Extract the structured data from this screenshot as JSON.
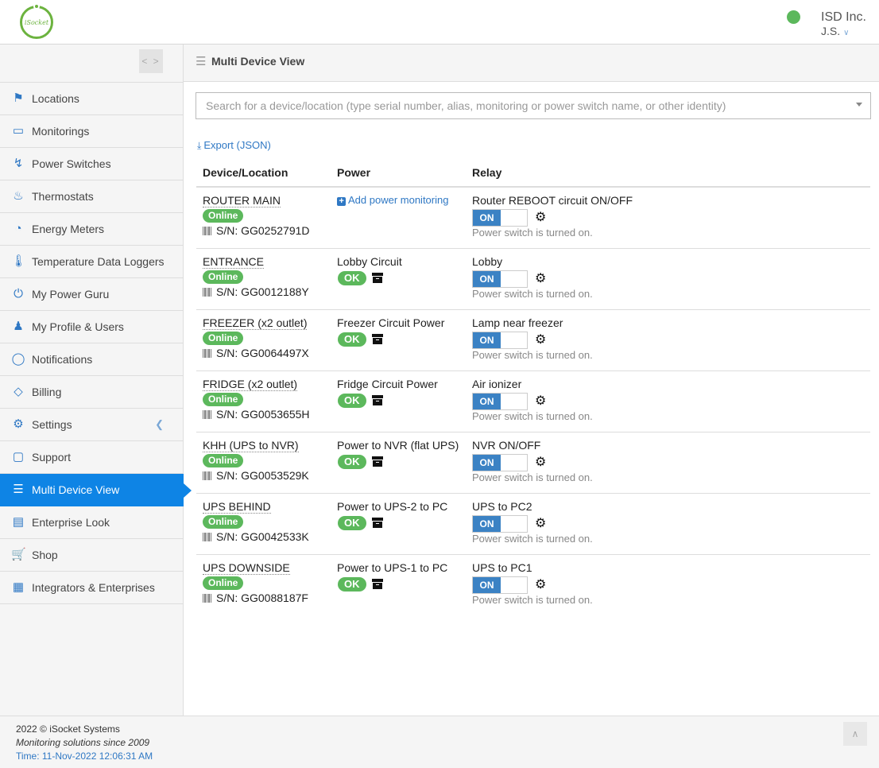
{
  "header": {
    "logo_text": "iSocket",
    "company": "ISD Inc.",
    "user": "J.S.",
    "status_color": "#5cb85c"
  },
  "sidebar": {
    "collapse_label": "< >",
    "items": [
      {
        "label": "Locations",
        "icon": "map-pin-icon"
      },
      {
        "label": "Monitorings",
        "icon": "monitor-icon"
      },
      {
        "label": "Power Switches",
        "icon": "plug-icon"
      },
      {
        "label": "Thermostats",
        "icon": "thermostat-icon"
      },
      {
        "label": "Energy Meters",
        "icon": "gauge-icon"
      },
      {
        "label": "Temperature Data Loggers",
        "icon": "thermometer-icon"
      },
      {
        "label": "My Power Guru",
        "icon": "power-icon"
      },
      {
        "label": "My Profile & Users",
        "icon": "users-icon"
      },
      {
        "label": "Notifications",
        "icon": "chat-bubble-icon"
      },
      {
        "label": "Billing",
        "icon": "tag-icon"
      },
      {
        "label": "Settings",
        "icon": "gears-icon"
      },
      {
        "label": "Support",
        "icon": "support-chat-icon"
      },
      {
        "label": "Multi Device View",
        "icon": "list-icon",
        "active": true
      },
      {
        "label": "Enterprise Look",
        "icon": "card-icon"
      },
      {
        "label": "Shop",
        "icon": "cart-icon"
      },
      {
        "label": "Integrators & Enterprises",
        "icon": "puzzle-icon"
      }
    ]
  },
  "main": {
    "title": "Multi Device View",
    "search_placeholder": "Search for a device/location (type serial number, alias, monitoring or power switch name, or other identity)",
    "export_label": "Export (JSON)",
    "columns": [
      "Device/Location",
      "Power",
      "Relay"
    ],
    "online_label": "Online",
    "ok_label": "OK",
    "on_label": "ON",
    "add_power_label": "Add power monitoring",
    "rows": [
      {
        "device": "ROUTER MAIN",
        "sn": "S/N: GG0252791D",
        "power": "",
        "relay": "Router REBOOT circuit ON/OFF",
        "relay_status": "Power switch is turned on."
      },
      {
        "device": "ENTRANCE",
        "sn": "S/N: GG0012188Y",
        "power": "Lobby Circuit",
        "relay": "Lobby",
        "relay_status": "Power switch is turned on."
      },
      {
        "device": "FREEZER (x2 outlet)",
        "sn": "S/N: GG0064497X",
        "power": "Freezer Circuit Power",
        "relay": "Lamp near freezer",
        "relay_status": "Power switch is turned on."
      },
      {
        "device": "FRIDGE (x2 outlet)",
        "sn": "S/N: GG0053655H",
        "power": "Fridge Circuit Power",
        "relay": "Air ionizer",
        "relay_status": "Power switch is turned on."
      },
      {
        "device": "KHH (UPS to NVR)",
        "sn": "S/N: GG0053529K",
        "power": "Power to NVR (flat UPS)",
        "relay": "NVR ON/OFF",
        "relay_status": "Power switch is turned on."
      },
      {
        "device": "UPS BEHIND",
        "sn": "S/N: GG0042533K",
        "power": "Power to UPS-2 to PC",
        "relay": "UPS to PC2",
        "relay_status": "Power switch is turned on."
      },
      {
        "device": "UPS DOWNSIDE",
        "sn": "S/N: GG0088187F",
        "power": "Power to UPS-1 to PC",
        "relay": "UPS to PC1",
        "relay_status": "Power switch is turned on."
      }
    ]
  },
  "footer": {
    "copyright": "2022 © iSocket Systems",
    "tagline": "Monitoring solutions since 2009",
    "time": "Time: 11-Nov-2022 12:06:31 AM"
  }
}
